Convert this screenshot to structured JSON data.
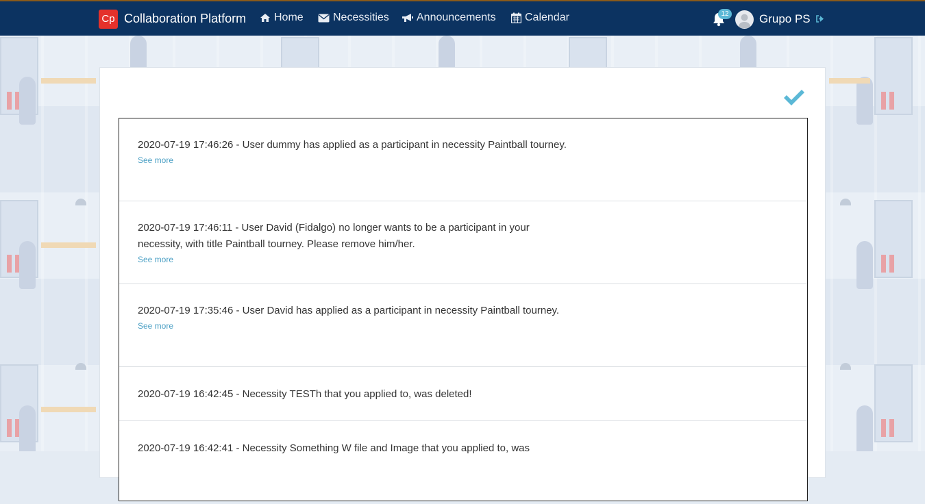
{
  "navbar": {
    "brand_logo": "Cp",
    "brand_name": "Collaboration Platform",
    "links": [
      {
        "label": "Home",
        "icon": "home-icon"
      },
      {
        "label": "Necessities",
        "icon": "envelope-icon"
      },
      {
        "label": "Announcements",
        "icon": "bullhorn-icon"
      },
      {
        "label": "Calendar",
        "icon": "calendar-icon"
      }
    ],
    "notification_count": "12",
    "user_name": "Grupo PS"
  },
  "notifications": [
    {
      "text": "2020-07-19 17:46:26 - User dummy has applied as a participant in necessity Paintball tourney.",
      "link": "See more"
    },
    {
      "text": "2020-07-19 17:46:11 - User David (Fidalgo) no longer wants to be a participant in your necessity, with title Paintball tourney. Please remove him/her.",
      "link": "See more"
    },
    {
      "text": "2020-07-19 17:35:46 - User David has applied as a participant in necessity Paintball tourney.",
      "link": "See more"
    },
    {
      "text": "2020-07-19 16:42:45 - Necessity  TESTh that you applied to, was deleted!"
    },
    {
      "text": "2020-07-19 16:42:41 - Necessity  Something W file and Image that you applied to, was"
    }
  ],
  "colors": {
    "navbar": "#0c3361",
    "accent": "#5bb8d6",
    "logo": "#e4312b",
    "link": "#4a9fc4"
  }
}
